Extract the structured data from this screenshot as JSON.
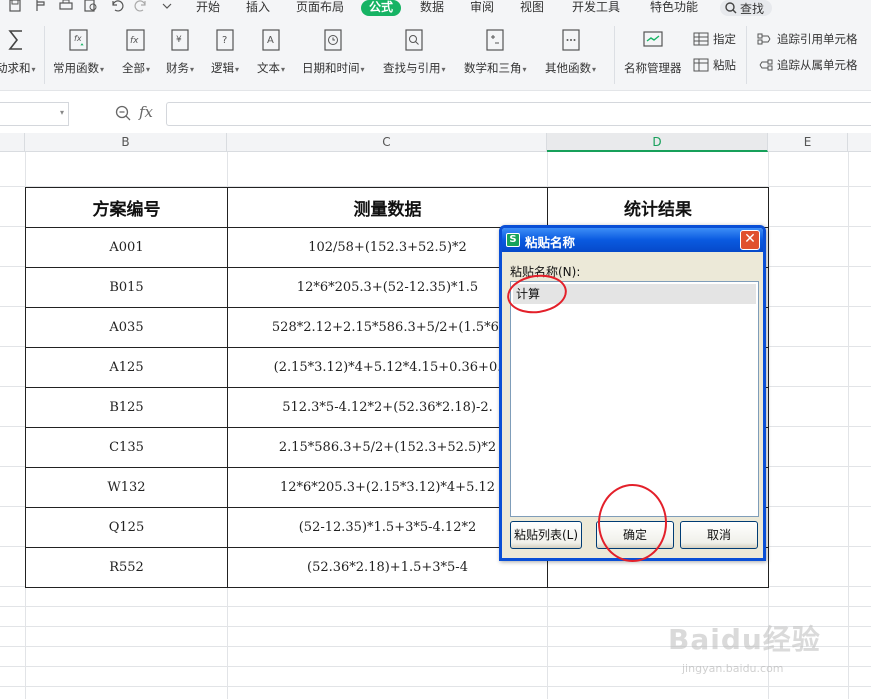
{
  "menubar": {
    "tabs": [
      "开始",
      "插入",
      "页面布局",
      "公式",
      "数据",
      "审阅",
      "视图",
      "开发工具",
      "特色功能"
    ],
    "active_tab": "公式",
    "search_label": "查找"
  },
  "ribbon": {
    "buttons": [
      "动求和",
      "常用函数",
      "全部",
      "财务",
      "逻辑",
      "文本",
      "日期和时间",
      "查找与引用",
      "数学和三角",
      "其他函数",
      "名称管理器"
    ],
    "small": {
      "assign": "指定",
      "paste": "粘贴",
      "trace_precedents": "追踪引用单元格",
      "trace_dependents": "追踪从属单元格"
    }
  },
  "formula_bar": {
    "fx_label": "fx",
    "name_value": "",
    "formula_value": ""
  },
  "grid": {
    "columns": [
      "B",
      "C",
      "D",
      "E"
    ],
    "selected_column": "D"
  },
  "table": {
    "headers": [
      "方案编号",
      "测量数据",
      "统计结果"
    ],
    "rows": [
      {
        "id": "A001",
        "data": "102/58+(152.3+52.5)*2"
      },
      {
        "id": "B015",
        "data": "12*6*205.3+(52-12.35)*1.5"
      },
      {
        "id": "A035",
        "data": "528*2.12+2.15*586.3+5/2+(1.5*6."
      },
      {
        "id": "A125",
        "data": "(2.15*3.12)*4+5.12*4.15+0.36+0."
      },
      {
        "id": "B125",
        "data": "512.3*5-4.12*2+(52.36*2.18)-2."
      },
      {
        "id": "C135",
        "data": "2.15*586.3+5/2+(152.3+52.5)*2"
      },
      {
        "id": "W132",
        "data": "12*6*205.3+(2.15*3.12)*4+5.12"
      },
      {
        "id": "Q125",
        "data": "(52-12.35)*1.5+3*5-4.12*2"
      },
      {
        "id": "R552",
        "data": "(52.36*2.18)+1.5+3*5-4"
      }
    ]
  },
  "dialog": {
    "title": "粘贴名称",
    "label": "粘贴名称(N):",
    "items": [
      "计算"
    ],
    "buttons": {
      "paste_list": "粘贴列表(L)",
      "ok": "确定",
      "cancel": "取消"
    },
    "close_glyph": "✕",
    "title_icon_glyph": "S"
  },
  "watermark": {
    "logo": "Baidu经验",
    "sub": "jingyan.baidu.com"
  },
  "colors": {
    "accent_green": "#16b364",
    "dialog_blue": "#0a4fd6",
    "annotation_red": "#e3202a"
  }
}
